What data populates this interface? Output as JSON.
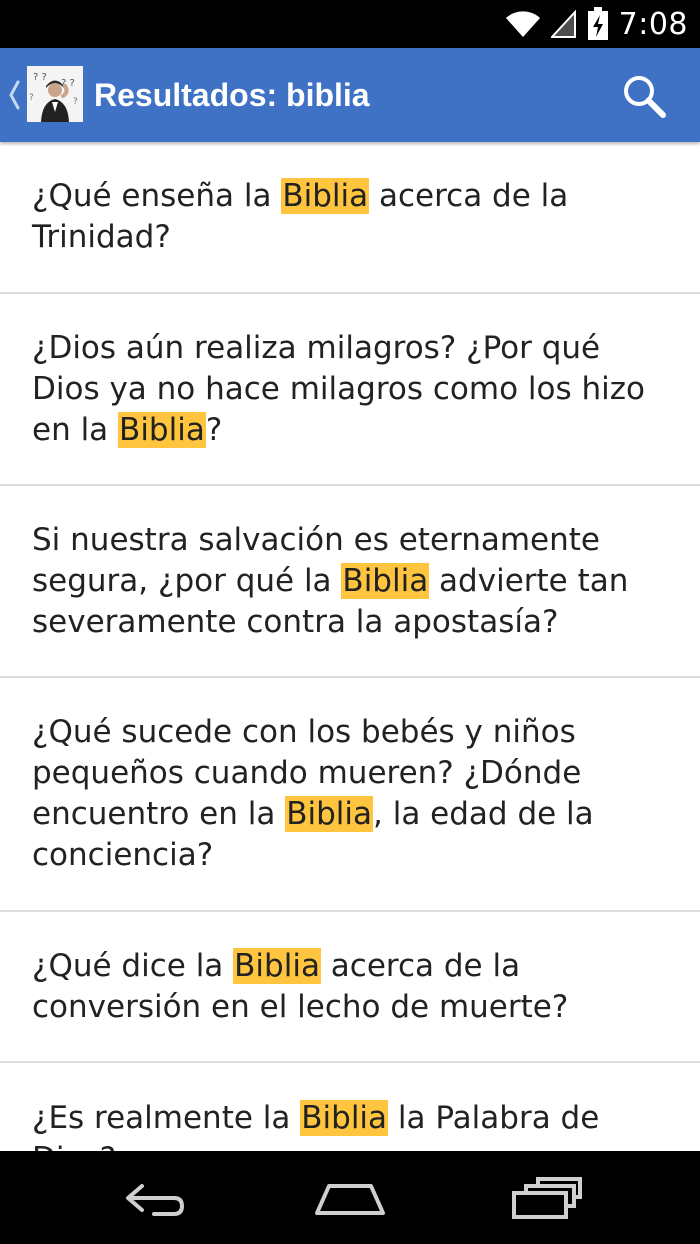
{
  "status_bar": {
    "time": "7:08",
    "icons": [
      "wifi-icon",
      "cell-signal-icon",
      "battery-charging-icon"
    ]
  },
  "action_bar": {
    "title": "Resultados: biblia",
    "icons": [
      "up-chevron-icon",
      "app-logo-icon",
      "search-icon"
    ]
  },
  "colors": {
    "status_bar": "#000000",
    "action_bar": "#3f72c4",
    "highlight": "#ffc53f",
    "divider": "#dedede",
    "text": "#222222"
  },
  "results": [
    {
      "before": "¿Qué enseña la ",
      "match": "Biblia",
      "after": " acerca de la Trinidad?"
    },
    {
      "before": "¿Dios aún realiza milagros? ¿Por qué Dios ya no hace milagros como los hizo en la ",
      "match": "Biblia",
      "after": "?"
    },
    {
      "before": "Si nuestra salvación es eternamente segura, ¿por qué la ",
      "match": "Biblia",
      "after": " advierte tan severamente contra la apostasía?"
    },
    {
      "before": "¿Qué sucede con los bebés y niños pequeños cuando mueren? ¿Dónde encuentro en la ",
      "match": "Biblia",
      "after": ", la edad de la conciencia?"
    },
    {
      "before": "¿Qué dice la ",
      "match": "Biblia",
      "after": " acerca de la conversión en el lecho de muerte?"
    },
    {
      "before": "¿Es realmente la ",
      "match": "Biblia",
      "after": " la Palabra de Dios?"
    }
  ],
  "nav_bar": {
    "icons": [
      "back-icon",
      "home-icon",
      "recent-apps-icon"
    ]
  }
}
